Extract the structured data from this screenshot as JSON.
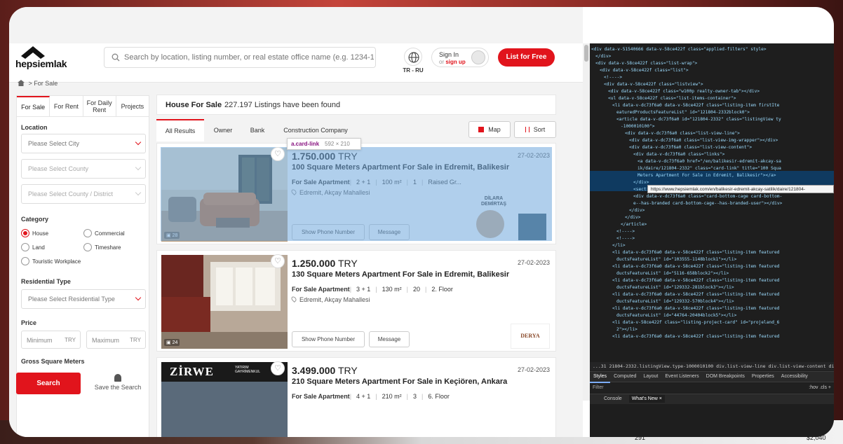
{
  "header": {
    "logo_text": "hepsiemlak",
    "search_placeholder": "Search by location, listing number, or real estate office name (e.g. 1234-123456",
    "lang_code": "TR - RU",
    "signin_label": "Sign In",
    "signin_or": "or",
    "signup_label": "sign up",
    "list_free_label": "List for Free"
  },
  "breadcrumb": {
    "current": "For Sale"
  },
  "sidebar": {
    "tabs": [
      "For Sale",
      "For Rent",
      "For Daily Rent",
      "Projects"
    ],
    "location_label": "Location",
    "city_placeholder": "Please Select City",
    "county_placeholder": "Please Select County",
    "district_placeholder": "Please Select County / District",
    "category_label": "Category",
    "categories": [
      "House",
      "Commercial",
      "Land",
      "Timeshare",
      "Touristic Workplace"
    ],
    "residential_label": "Residential Type",
    "residential_placeholder": "Please Select Residential Type",
    "price_label": "Price",
    "min_placeholder": "Minimum",
    "max_placeholder": "Maximum",
    "currency": "TRY",
    "gross_label": "Gross Square Meters",
    "search_button": "Search",
    "save_search": "Save the Search"
  },
  "main": {
    "title": "House For Sale",
    "count": "227.197 Listings have been found",
    "tabs": [
      "All Results",
      "Owner",
      "Bank",
      "Construction Company"
    ],
    "map_button": "Map",
    "sort_button": "Sort",
    "tooltip_tag": "a.card-link",
    "tooltip_size": "592 × 210"
  },
  "listings": [
    {
      "price": "1.750.000",
      "currency": "TRY",
      "date": "27-02-2023",
      "title": "100 Square Meters Apartment For Sale in Edremit, Balikesir",
      "type": "For Sale Apartment",
      "rooms": "2 + 1",
      "area": "100 m²",
      "floor": "1",
      "extra": "Raised Gr...",
      "location": "Edremit, Akçay Mahallesi",
      "photo_count": "28",
      "agent_name": "DİLARA DEMİRTAŞ",
      "phone_button": "Show Phone Number",
      "message_button": "Message"
    },
    {
      "price": "1.250.000",
      "currency": "TRY",
      "date": "27-02-2023",
      "title": "130 Square Meters Apartment For Sale in Edremit, Balikesir",
      "type": "For Sale Apartment",
      "rooms": "3 + 1",
      "area": "130 m²",
      "floor": "20",
      "extra": "2. Floor",
      "location": "Edremit, Akçay Mahallesi",
      "photo_count": "24",
      "agent_name": "DERYA",
      "phone_button": "Show Phone Number",
      "message_button": "Message"
    },
    {
      "price": "3.499.000",
      "currency": "TRY",
      "date": "27-02-2023",
      "title": "210 Square Meters Apartment For Sale in Keçiören, Ankara",
      "type": "For Sale Apartment",
      "rooms": "4 + 1",
      "area": "210 m²",
      "floor": "3",
      "extra": "6. Floor",
      "banner": "ZİRWE",
      "banner_sub": "YATIRIM GAYRİMENKUL"
    }
  ],
  "devtools": {
    "lines": [
      "<div data-v-51540666 data-v-58ce422f class=\"applied-filters\" style>",
      "</div>",
      "<div data-v-58ce422f class=\"list-wrap\">",
      "<div data-v-58ce422f class=\"list\">",
      "<!---->",
      "<div data-v-58ce422f class=\"listview\">",
      "<div data-v-58ce422f class=\"w100p realty-owner-tab\"></div>",
      "<ul data-v-58ce422f class=\"list-items-container\">",
      "<li data-v-dc73f6a0 data-v-58ce422f class=\"listing-item firstIte",
      "eaturedProductsFeatureList\" id=\"121804-2332block0\">",
      "<article data-v-dc73f6a0 id=\"121804-2332\" class=\"listingView ty",
      "-1000010100\">",
      "<div data-v-dc73f6a0 class=\"list-view-line\">",
      "<div data-v-dc73f6a0 class=\"list-view-img-wrapper\"></div>",
      "<div data-v-dc73f6a0 class=\"list-view-content\">",
      "<div data-v-dc73f6a0 class=\"links\">",
      "<a data-v-dc73f6a0 href=\"/en/balikesir-edremit-akcay-sa",
      "ik/daire/121804-2332\" class=\"card-link\" title=\"100 Squa",
      "Meters Apartment For Sale in Edremit, Balikesir\"></a>",
      "</div>",
      "<section data-v-dc73f6a0 class=\"upper sibling\"></section>",
      "<div data-v-dc73f6a0 class=\"card-bottom-cage card-bottom-",
      "e--has-branded card-bottom-cage--has-branded-user\"></div>",
      "</div>",
      "</div>",
      "</article>",
      "<!---->",
      "<!---->",
      "</li>",
      "<li data-v-dc73f6a0 data-v-58ce422f class=\"listing-item featured",
      "ductsFeatureList\" id=\"103555-1148block1\"></li>",
      "<li data-v-dc73f6a0 data-v-58ce422f class=\"listing-item featured",
      "ductsFeatureList\" id=\"5116-658block2\"></li>",
      "<li data-v-dc73f6a0 data-v-58ce422f class=\"listing-item featured",
      "ductsFeatureList\" id=\"129332-281block3\"></li>",
      "<li data-v-dc73f6a0 data-v-58ce422f class=\"listing-item featured",
      "ductsFeatureList\" id=\"129332-570block4\"></li>",
      "<li data-v-dc73f6a0 data-v-58ce422f class=\"listing-item featured",
      "ductsFeatureList\" id=\"44764-20404block5\"></li>",
      "<li data-v-58ce422f class=\"listing-project-card\" id=\"projeland_6",
      "2\"></li>",
      "<li data-v-dc73f6a0 data-v-58ce422f class=\"listing-item featured"
    ],
    "url_tooltip": "https://www.hepsiemlak.com/en/balikesir-edremit-akcay-satilik/daire/121804-",
    "breadcrumb": "...31 21804-2332.listingView.type-1000010100   div.list-view-line   div.list-view-content   div.links   a.card-lin",
    "tabs": [
      "Styles",
      "Computed",
      "Layout",
      "Event Listeners",
      "DOM Breakpoints",
      "Properties",
      "Accessibility"
    ],
    "filter_placeholder": "Filter",
    "filter_right": ":hov  .cls  +",
    "bottom_tabs": [
      "Console",
      "What's New ×"
    ]
  },
  "background": {
    "nums": [
      "291",
      "$2,040"
    ]
  },
  "colors": {
    "brand": "#e1141c",
    "highlight": "#6fa8dc"
  }
}
